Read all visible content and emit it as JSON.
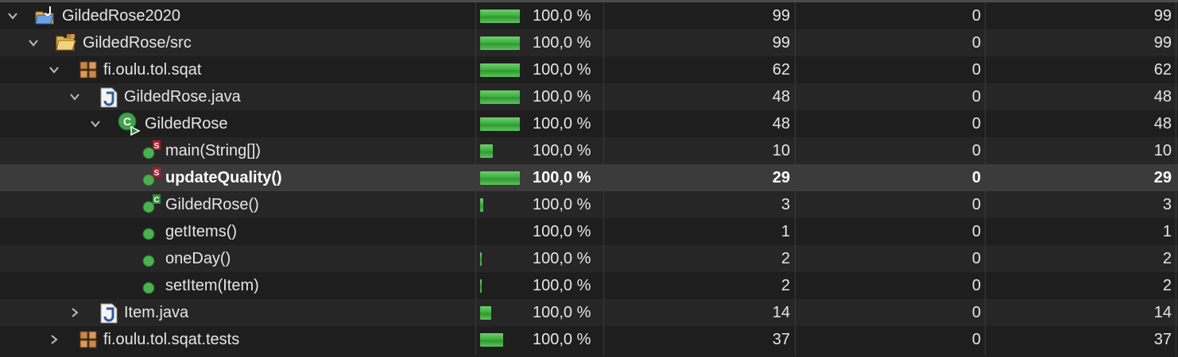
{
  "rows": [
    {
      "label": "GildedRose2020",
      "pct": "100,0 %",
      "covered": "99",
      "missed": "0",
      "total": "99",
      "coverage": 1.0,
      "bar_fraction": 1.0,
      "icon": "java-project-icon",
      "expanded": true
    },
    {
      "label": "GildedRose/src",
      "pct": "100,0 %",
      "covered": "99",
      "missed": "0",
      "total": "99",
      "coverage": 1.0,
      "bar_fraction": 1.0,
      "icon": "source-folder-icon",
      "expanded": true
    },
    {
      "label": "fi.oulu.tol.sqat",
      "pct": "100,0 %",
      "covered": "62",
      "missed": "0",
      "total": "62",
      "coverage": 1.0,
      "bar_fraction": 1.0,
      "icon": "package-icon",
      "expanded": true
    },
    {
      "label": "GildedRose.java",
      "pct": "100,0 %",
      "covered": "48",
      "missed": "0",
      "total": "48",
      "coverage": 1.0,
      "bar_fraction": 1.0,
      "icon": "java-file-icon",
      "expanded": true
    },
    {
      "label": "GildedRose",
      "pct": "100,0 %",
      "covered": "48",
      "missed": "0",
      "total": "48",
      "coverage": 1.0,
      "bar_fraction": 1.0,
      "icon": "class-icon",
      "expanded": true
    },
    {
      "label": "main(String[])",
      "pct": "100,0 %",
      "covered": "10",
      "missed": "0",
      "total": "10",
      "coverage": 1.0,
      "bar_fraction": 0.32,
      "icon": "static-method-icon"
    },
    {
      "label": "updateQuality()",
      "pct": "100,0 %",
      "covered": "29",
      "missed": "0",
      "total": "29",
      "coverage": 1.0,
      "bar_fraction": 1.0,
      "icon": "static-method-icon",
      "selected": true
    },
    {
      "label": "GildedRose()",
      "pct": "100,0 %",
      "covered": "3",
      "missed": "0",
      "total": "3",
      "coverage": 1.0,
      "bar_fraction": 0.08,
      "icon": "constructor-icon"
    },
    {
      "label": "getItems()",
      "pct": "100,0 %",
      "covered": "1",
      "missed": "0",
      "total": "1",
      "coverage": 1.0,
      "bar_fraction": 0.0,
      "icon": "method-icon"
    },
    {
      "label": "oneDay()",
      "pct": "100,0 %",
      "covered": "2",
      "missed": "0",
      "total": "2",
      "coverage": 1.0,
      "bar_fraction": 0.04,
      "icon": "method-icon"
    },
    {
      "label": "setItem(Item)",
      "pct": "100,0 %",
      "covered": "2",
      "missed": "0",
      "total": "2",
      "coverage": 1.0,
      "bar_fraction": 0.04,
      "icon": "method-icon"
    },
    {
      "label": "Item.java",
      "pct": "100,0 %",
      "covered": "14",
      "missed": "0",
      "total": "14",
      "coverage": 1.0,
      "bar_fraction": 0.28,
      "icon": "java-file-icon",
      "expanded": false
    },
    {
      "label": "fi.oulu.tol.sqat.tests",
      "pct": "100,0 %",
      "covered": "37",
      "missed": "0",
      "total": "37",
      "coverage": 1.0,
      "bar_fraction": 0.58,
      "icon": "package-icon",
      "expanded": false
    }
  ],
  "colors": {
    "coverage_bar": "#3fae3f",
    "selected_row": "#3b3b3b",
    "background": "#1f1f1f"
  }
}
